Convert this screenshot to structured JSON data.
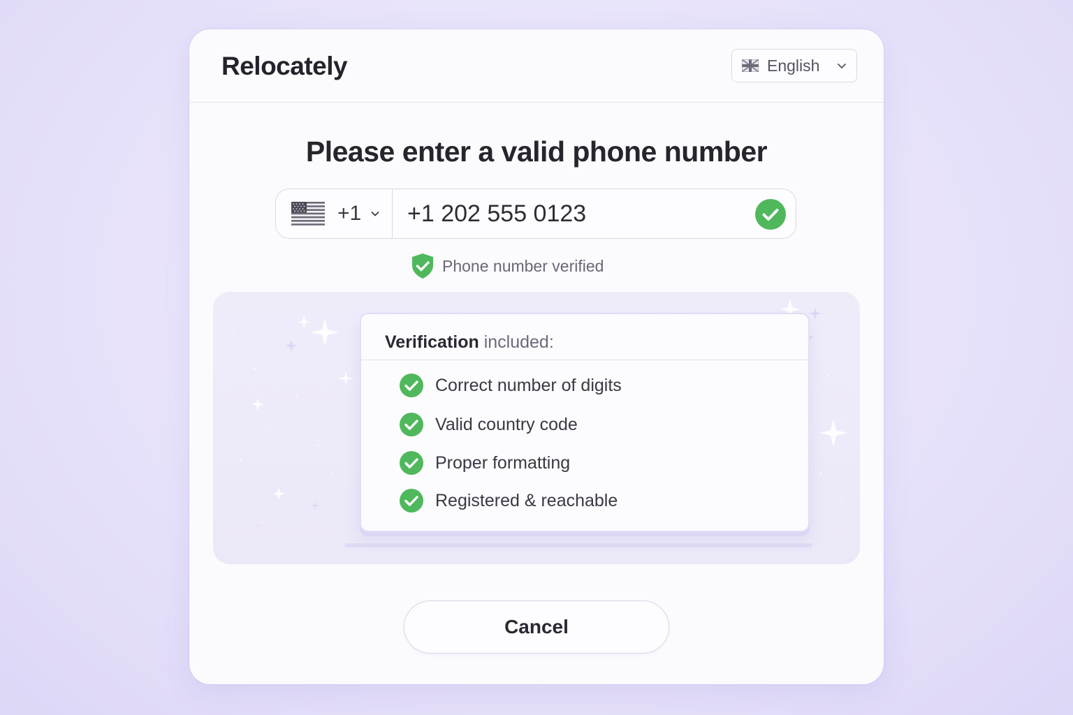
{
  "header": {
    "brand": "Relocately",
    "language": {
      "label": "English",
      "flag_icon": "uk-flag-icon"
    }
  },
  "title": "Please enter a valid phone number",
  "phone": {
    "country_flag_icon": "us-flag-icon",
    "country_code": "+1",
    "value": "+1 202 555 0123",
    "valid": true
  },
  "status": {
    "verified_label": "Phone number verified"
  },
  "checklist": {
    "heading_strong": "Verification",
    "heading_rest": " included:",
    "items": [
      {
        "label": "Correct number of digits",
        "ok": true
      },
      {
        "label": "Valid country code",
        "ok": true
      },
      {
        "label": "Proper formatting",
        "ok": true
      },
      {
        "label": "Registered & reachable",
        "ok": true
      }
    ]
  },
  "actions": {
    "cancel_label": "Cancel"
  },
  "colors": {
    "success": "#4fb85c",
    "background": "#e6e1fa",
    "card": "#fbfafd",
    "text": "#26252d"
  }
}
